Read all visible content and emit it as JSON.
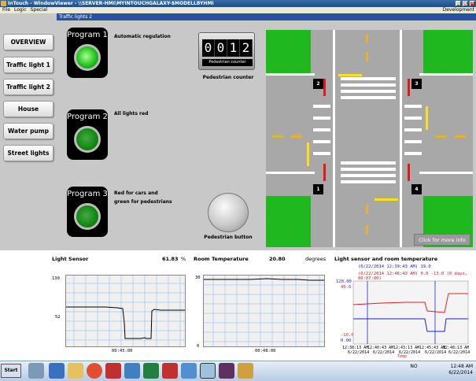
{
  "app": {
    "title": "InTouch - WindowViewer - \\\\SERVER-HMI\\MYINTOUCHGALAXY-$MODELLBYHMI",
    "menu": [
      "File",
      "Logic",
      "Special"
    ],
    "menu_right": "Development",
    "window_title": "Traffic lights 2"
  },
  "nav": [
    {
      "label": "OVERVIEW"
    },
    {
      "label": "Traffic light 1"
    },
    {
      "label": "Traffic light 2"
    },
    {
      "label": "House"
    },
    {
      "label": "Water pump"
    },
    {
      "label": "Street lights"
    }
  ],
  "programs": [
    {
      "label": "Program 1",
      "desc": "Automatic regulation",
      "state": "on"
    },
    {
      "label": "Program 2",
      "desc": "All lights red",
      "state": "off"
    },
    {
      "label": "Program 3",
      "desc_line1": "Red for cars and",
      "desc_line2": "green for pedestrians",
      "state": "off"
    }
  ],
  "counter": {
    "digits": [
      "0",
      "0",
      "1",
      "2"
    ],
    "inner_label": "Pedestrian counter",
    "caption": "Pedestrian counter"
  },
  "ped_button": {
    "caption": "Pedestrian button"
  },
  "intersection": {
    "signals": [
      "2",
      "3",
      "1",
      "4"
    ],
    "more_info": "Click for more info"
  },
  "light_sensor": {
    "title": "Light Sensor",
    "value": "61.83",
    "unit": "%",
    "y_top": "130",
    "y_mid": "52",
    "time": "00:45:00"
  },
  "room_temp": {
    "title": "Room Temperature",
    "value": "20.80",
    "unit": "degrees",
    "y_top": "30",
    "y_bottom": "0",
    "time": "00:48:00"
  },
  "combined": {
    "title": "Light sensor and room temperature",
    "cursor1": "(6/22/2014 12:39:43 AM) 19.0",
    "cursor2": "(6/22/2014 12:46:43 AM) 0.0 -13.0 (0 days, 00:07:00)",
    "y_top_blue": "120.00",
    "y_top_red": "40.0",
    "y_bot_red": "-10.0",
    "y_bot_blue": "0.00",
    "x_labels": [
      {
        "t": "12:38:13 AM",
        "d": "6/22/2014"
      },
      {
        "t": "12:40:43 AM",
        "d": "6/22/2014"
      },
      {
        "t": "12:43:13 AM",
        "d": "6/22/2014"
      },
      {
        "t": "12:45:43 AM",
        "d": "6/22/2014"
      },
      {
        "t": "12:48:13 AM",
        "d": "6/22/2014"
      }
    ],
    "legend": "Temp",
    "colors": {
      "light": "#2020d0",
      "temp": "#e02020"
    }
  },
  "taskbar": {
    "start": "Start",
    "lang": "NO",
    "time": "12:48 AM",
    "date": "6/22/2014"
  },
  "colors": {
    "grass": "#1fb81f",
    "road": "#a8a8a8",
    "lamp_on": "#22c022",
    "title_blue": "#2a50a0"
  }
}
